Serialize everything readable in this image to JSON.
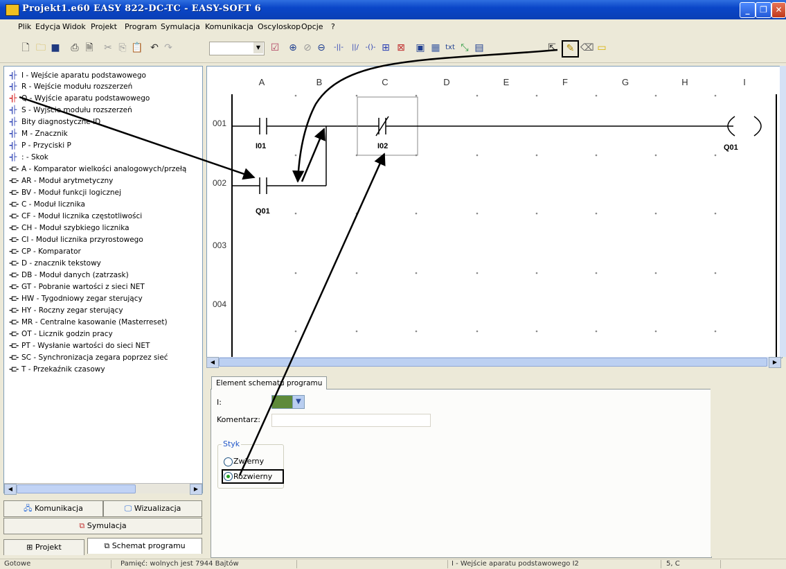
{
  "window": {
    "title": "Projekt1.e60 EASY 822-DC-TC - EASY-SOFT 6",
    "buttons": {
      "minimize": "_",
      "maximize": "❐",
      "close": "✕"
    }
  },
  "menu": [
    "Plik",
    "Edycja",
    "Widok",
    "Projekt",
    "Program",
    "Symulacja",
    "Komunikacja",
    "Oscyloskop",
    "Opcje",
    "?"
  ],
  "toolbar": {
    "icons": [
      "new-document-icon",
      "open-folder-icon",
      "save-icon",
      "print-icon",
      "print-preview-icon",
      "cut-icon",
      "copy-icon",
      "paste-icon",
      "undo-icon",
      "redo-icon",
      "combo",
      "check-icon",
      "zoom-in-icon",
      "zoom-reset-icon",
      "zoom-out-icon",
      "contact-no-icon",
      "contact-nc-icon",
      "coil-icon",
      "function-block-icon",
      "function-block-disabled-icon",
      "grid-view-icon",
      "grid-dots-icon",
      "text-icon",
      "connect-icon",
      "table-icon",
      "cursor-icon",
      "pencil-icon",
      "eraser-icon",
      "comment-icon"
    ],
    "selected_tool": "pencil-icon"
  },
  "tree": {
    "items": [
      {
        "icon": "contact",
        "color": "#2a3fb3",
        "label": "I - Wejście aparatu podstawowego"
      },
      {
        "icon": "contact",
        "color": "#2a3fb3",
        "label": "R - Wejście modułu rozszerzeń"
      },
      {
        "icon": "contact",
        "color": "#d42020",
        "label": "Q - Wyjście aparatu podstawowego"
      },
      {
        "icon": "contact",
        "color": "#2a3fb3",
        "label": "S - Wyjście modułu rozszerzeń"
      },
      {
        "icon": "contact",
        "color": "#2a3fb3",
        "label": "Bity diagnostyczne ID"
      },
      {
        "icon": "contact",
        "color": "#2a3fb3",
        "label": "M - Znacznik"
      },
      {
        "icon": "contact",
        "color": "#2a3fb3",
        "label": "P - Przyciski P"
      },
      {
        "icon": "contact",
        "color": "#2a3fb3",
        "label": ": - Skok"
      },
      {
        "icon": "block",
        "color": "#222222",
        "label": "A - Komparator wielkości analogowych/przełą"
      },
      {
        "icon": "block",
        "color": "#222222",
        "label": "AR - Moduł arytmetyczny"
      },
      {
        "icon": "block",
        "color": "#222222",
        "label": "BV - Moduł funkcji logicznej"
      },
      {
        "icon": "block",
        "color": "#222222",
        "label": "C - Moduł licznika"
      },
      {
        "icon": "block",
        "color": "#222222",
        "label": "CF - Moduł licznika częstotliwości"
      },
      {
        "icon": "block",
        "color": "#222222",
        "label": "CH - Moduł szybkiego licznika"
      },
      {
        "icon": "block",
        "color": "#222222",
        "label": "CI - Moduł licznika przyrostowego"
      },
      {
        "icon": "block",
        "color": "#222222",
        "label": "CP - Komparator"
      },
      {
        "icon": "block",
        "color": "#222222",
        "label": "D - znacznik tekstowy"
      },
      {
        "icon": "block",
        "color": "#222222",
        "label": "DB - Moduł danych (zatrzask)"
      },
      {
        "icon": "block",
        "color": "#222222",
        "label": "GT - Pobranie wartości z sieci NET"
      },
      {
        "icon": "block",
        "color": "#222222",
        "label": "HW - Tygodniowy zegar sterujący"
      },
      {
        "icon": "block",
        "color": "#222222",
        "label": "HY - Roczny zegar sterujący"
      },
      {
        "icon": "block",
        "color": "#222222",
        "label": "MR - Centralne kasowanie (Masterreset)"
      },
      {
        "icon": "block",
        "color": "#222222",
        "label": "OT - Licznik godzin pracy"
      },
      {
        "icon": "block",
        "color": "#222222",
        "label": "PT - Wysłanie wartości do sieci NET"
      },
      {
        "icon": "block",
        "color": "#222222",
        "label": "SC - Synchronizacja zegara poprzez sieć"
      },
      {
        "icon": "block",
        "color": "#222222",
        "label": "T - Przekaźnik czasowy"
      }
    ]
  },
  "left_buttons": {
    "komunikacja": "Komunikacja",
    "wizualizacja": "Wizualizacja",
    "symulacja": "Symulacja",
    "projekt": "Projekt",
    "schemat": "Schemat programu"
  },
  "diagram": {
    "columns": [
      "A",
      "B",
      "C",
      "D",
      "E",
      "F",
      "G",
      "H",
      "I"
    ],
    "rows": [
      "001",
      "002",
      "003",
      "004"
    ],
    "elements": [
      {
        "type": "contact-no",
        "label": "I01"
      },
      {
        "type": "contact-nc",
        "label": "I02"
      },
      {
        "type": "coil",
        "label": "Q01"
      },
      {
        "type": "contact-no",
        "label": "Q01"
      }
    ]
  },
  "properties": {
    "tab": "Element schematu programu",
    "i_label": "I:",
    "i_value": "",
    "comment_label": "Komentarz:",
    "comment_value": "",
    "group_label": "Styk",
    "option_1": "Zwierny",
    "option_2": "Rozwierny",
    "selected": "Rozwierny"
  },
  "statusbar": {
    "ready": "Gotowe",
    "memory": "Pamięć: wolnych jest 7944 Bajtów",
    "element": "I - Wejście aparatu podstawowego I2",
    "position": "5, C"
  }
}
